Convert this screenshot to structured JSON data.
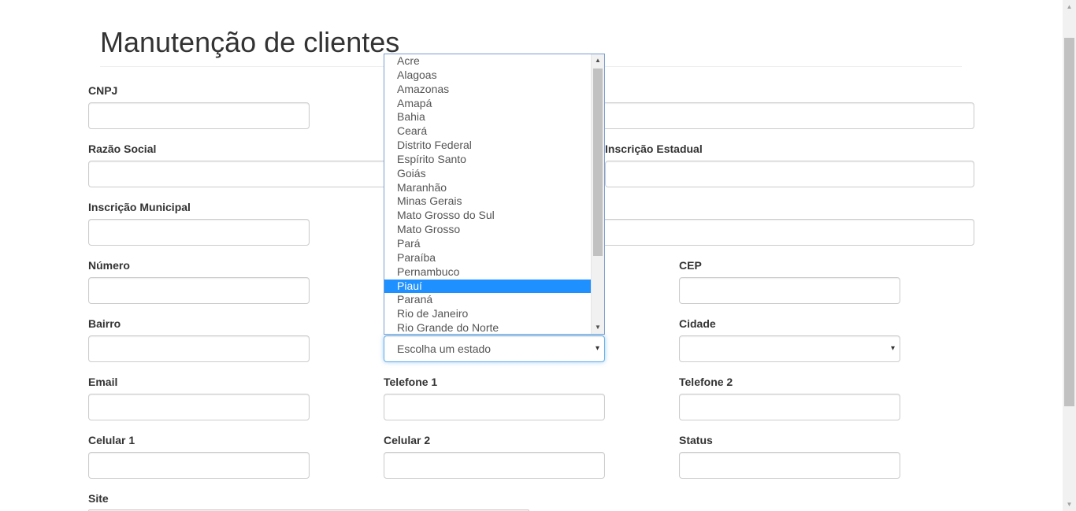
{
  "page": {
    "title": "Manutenção de clientes"
  },
  "labels": {
    "cnpj": "CNPJ",
    "razao_social": "Razão Social",
    "inscricao_estadual": "Inscrição Estadual",
    "inscricao_municipal": "Inscrição Municipal",
    "numero": "Número",
    "cep": "CEP",
    "bairro": "Bairro",
    "cidade": "Cidade",
    "email": "Email",
    "telefone1": "Telefone 1",
    "telefone2": "Telefone 2",
    "celular1": "Celular 1",
    "celular2": "Celular 2",
    "status": "Status",
    "site": "Site"
  },
  "estado_select": {
    "value": "Escolha um estado",
    "arrow_icon": "▾",
    "options": [
      "Acre",
      "Alagoas",
      "Amazonas",
      "Amapá",
      "Bahia",
      "Ceará",
      "Distrito Federal",
      "Espírito Santo",
      "Goiás",
      "Maranhão",
      "Minas Gerais",
      "Mato Grosso do Sul",
      "Mato Grosso",
      "Pará",
      "Paraíba",
      "Pernambuco",
      "Piauí",
      "Paraná",
      "Rio de Janeiro",
      "Rio Grande do Norte"
    ],
    "highlighted": "Piauí",
    "highlight_color": "#1e90ff"
  },
  "cidade_select": {
    "value": "",
    "arrow_icon": "▾"
  }
}
